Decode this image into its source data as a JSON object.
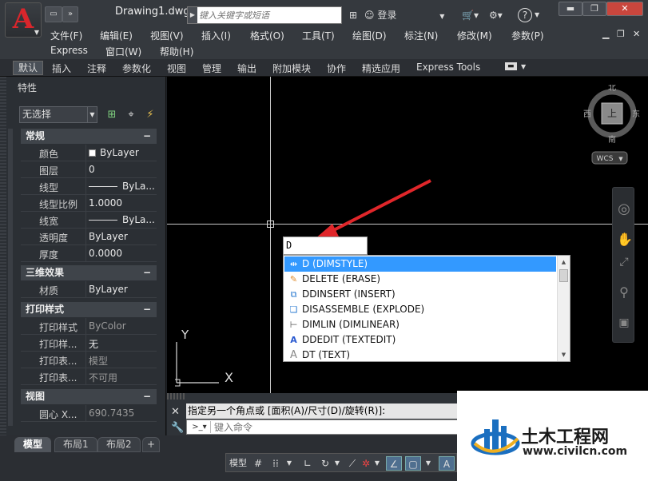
{
  "titlebar": {
    "document": "Drawing1.dwg",
    "search_placeholder": "键入关键字或短语",
    "login": "登录",
    "help": "?",
    "win_min": "▬",
    "win_max": "❐",
    "win_close": "✕"
  },
  "menus": [
    "文件(F)",
    "编辑(E)",
    "视图(V)",
    "插入(I)",
    "格式(O)",
    "工具(T)",
    "绘图(D)",
    "标注(N)",
    "修改(M)",
    "参数(P)",
    "Express",
    "窗口(W)",
    "帮助(H)"
  ],
  "ribbon_tabs": [
    "默认",
    "插入",
    "注释",
    "参数化",
    "视图",
    "管理",
    "输出",
    "附加模块",
    "协作",
    "精选应用",
    "Express Tools"
  ],
  "palette": {
    "title": "特性",
    "selection": "无选择",
    "sections": {
      "general": "常规",
      "three_d": "三维效果",
      "plot": "打印样式",
      "view": "视图"
    },
    "general_rows": [
      {
        "k": "颜色",
        "v": "ByLayer"
      },
      {
        "k": "图层",
        "v": "0"
      },
      {
        "k": "线型",
        "v": "ByLa..."
      },
      {
        "k": "线型比例",
        "v": "1.0000"
      },
      {
        "k": "线宽",
        "v": "ByLa..."
      },
      {
        "k": "透明度",
        "v": "ByLayer"
      },
      {
        "k": "厚度",
        "v": "0.0000"
      }
    ],
    "three_d_rows": [
      {
        "k": "材质",
        "v": "ByLayer"
      }
    ],
    "plot_rows": [
      {
        "k": "打印样式",
        "v": "ByColor"
      },
      {
        "k": "打印样...",
        "v": "无"
      },
      {
        "k": "打印表...",
        "v": "模型"
      },
      {
        "k": "打印表...",
        "v": "不可用"
      }
    ],
    "view_rows": [
      {
        "k": "圆心 X...",
        "v": "690.7435"
      }
    ]
  },
  "viewcube": {
    "north": "北",
    "south": "南",
    "east": "东",
    "west": "西",
    "face": "上",
    "wcs": "WCS"
  },
  "ucs": {
    "x": "X",
    "y": "Y"
  },
  "command_input": "D",
  "autocomplete": [
    {
      "label": "D (DIMSTYLE)",
      "icon": "dimstyle-icon"
    },
    {
      "label": "DELETE (ERASE)",
      "icon": "erase-icon"
    },
    {
      "label": "DDINSERT (INSERT)",
      "icon": "insert-icon"
    },
    {
      "label": "DISASSEMBLE (EXPLODE)",
      "icon": "explode-icon"
    },
    {
      "label": "DIMLIN (DIMLINEAR)",
      "icon": "dimlinear-icon"
    },
    {
      "label": "DDEDIT (TEXTEDIT)",
      "icon": "textedit-icon"
    },
    {
      "label": "DT (TEXT)",
      "icon": "text-icon"
    }
  ],
  "cmdbar": {
    "history": "指定另一个角点或 [面积(A)/尺寸(D)/旋转(R)]:",
    "placeholder": "键入命令"
  },
  "layout_tabs": [
    "模型",
    "布局1",
    "布局2",
    "+"
  ],
  "status": {
    "model": "模型"
  },
  "watermark": {
    "name": "土木工程网",
    "url": "www.civilcn.com"
  },
  "colors": {
    "accent_blue": "#3399ff",
    "logo_red": "#d8262c",
    "arrow_red": "#e0262a"
  }
}
